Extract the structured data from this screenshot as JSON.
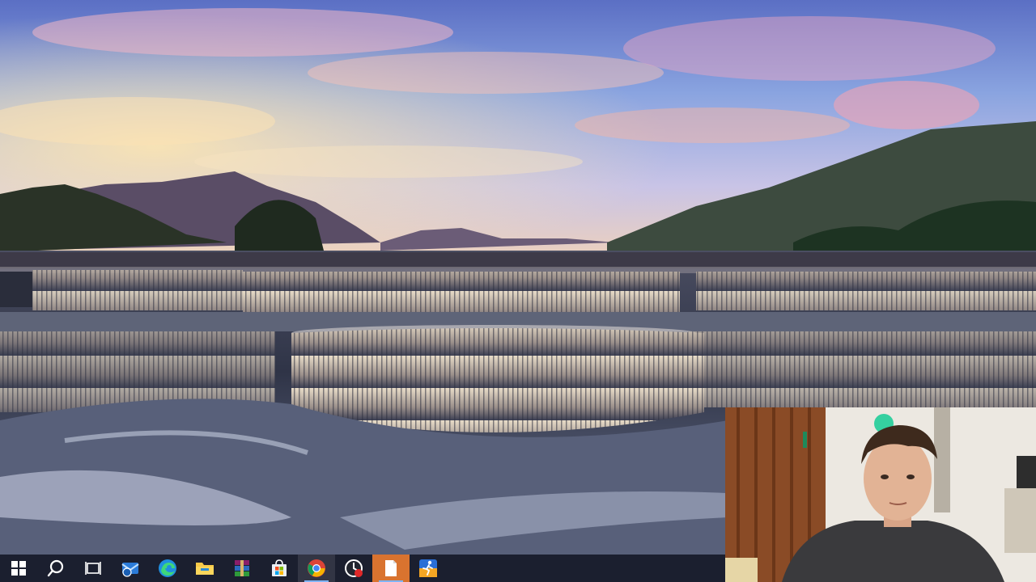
{
  "colors": {
    "taskbar_bg": "#161a26",
    "taskbar_active_indicator": "#7fb4f5",
    "taskbar_highlight": "#d9732f"
  },
  "desktop": {
    "wallpaper": "waterfall-terraces-landscape"
  },
  "webcam_overlay": {
    "content": "person-webcam-feed"
  },
  "taskbar": {
    "items": [
      {
        "id": "start",
        "icon": "windows-logo-icon",
        "active": false
      },
      {
        "id": "search",
        "icon": "search-icon",
        "active": false
      },
      {
        "id": "task-view",
        "icon": "task-view-icon",
        "active": false
      },
      {
        "id": "mail",
        "icon": "mail-icon",
        "active": false
      },
      {
        "id": "edge",
        "icon": "edge-browser-icon",
        "active": false
      },
      {
        "id": "file-explorer",
        "icon": "folder-icon",
        "active": false
      },
      {
        "id": "winrar",
        "icon": "winrar-icon",
        "active": false
      },
      {
        "id": "store",
        "icon": "store-icon",
        "active": false
      },
      {
        "id": "chrome",
        "icon": "chrome-icon",
        "active": true
      },
      {
        "id": "recorder",
        "icon": "screen-recorder-icon",
        "active": false
      },
      {
        "id": "document",
        "icon": "document-icon",
        "active": true
      },
      {
        "id": "runner-app",
        "icon": "runner-app-icon",
        "active": false
      }
    ]
  }
}
